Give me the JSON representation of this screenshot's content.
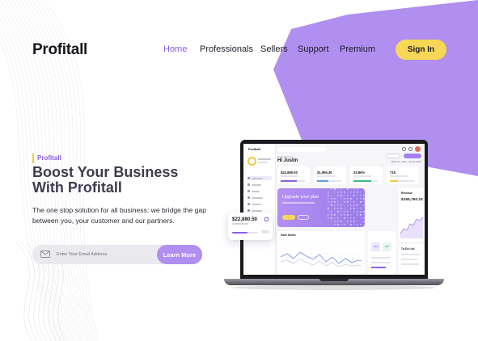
{
  "brand": {
    "name": "Profitall"
  },
  "nav": {
    "items": [
      {
        "label": "Home",
        "active": true
      },
      {
        "label": "Professionals",
        "active": false
      },
      {
        "label": "Sellers",
        "active": false
      },
      {
        "label": "Support",
        "active": false
      },
      {
        "label": "Premium",
        "active": false
      }
    ],
    "signin_label": "Sign In"
  },
  "hero": {
    "tag": "Profitall",
    "headline_line1": "Boost Your Business",
    "headline_line2": "With Profitall",
    "description": "The one stop solution for all business: we bridge the gap between you, your customer and our partners.",
    "email_placeholder": "Enter Your Email Address",
    "cta_label": "Learn More"
  },
  "dashboard": {
    "brand": "Profitall",
    "greeting": "Hi Justin",
    "stats": [
      "$22,880.50",
      "$1,996.30",
      "33.86%",
      "71K"
    ],
    "upgrade_title": "Upgrade your plan",
    "sales_title": "Sale Index",
    "revenue_title": "Revenue",
    "revenue_value": "$165,750.23",
    "todo_title": "To-Do List",
    "mini_values": [
      "560",
      "$2K"
    ]
  },
  "float_card": {
    "value": "$22,880.50",
    "progress": 0.6
  },
  "colors": {
    "accent": "#8a5fe0",
    "purple_shape": "#b08ff0",
    "yellow": "#f7d755"
  },
  "icons": [
    "mail-icon"
  ]
}
